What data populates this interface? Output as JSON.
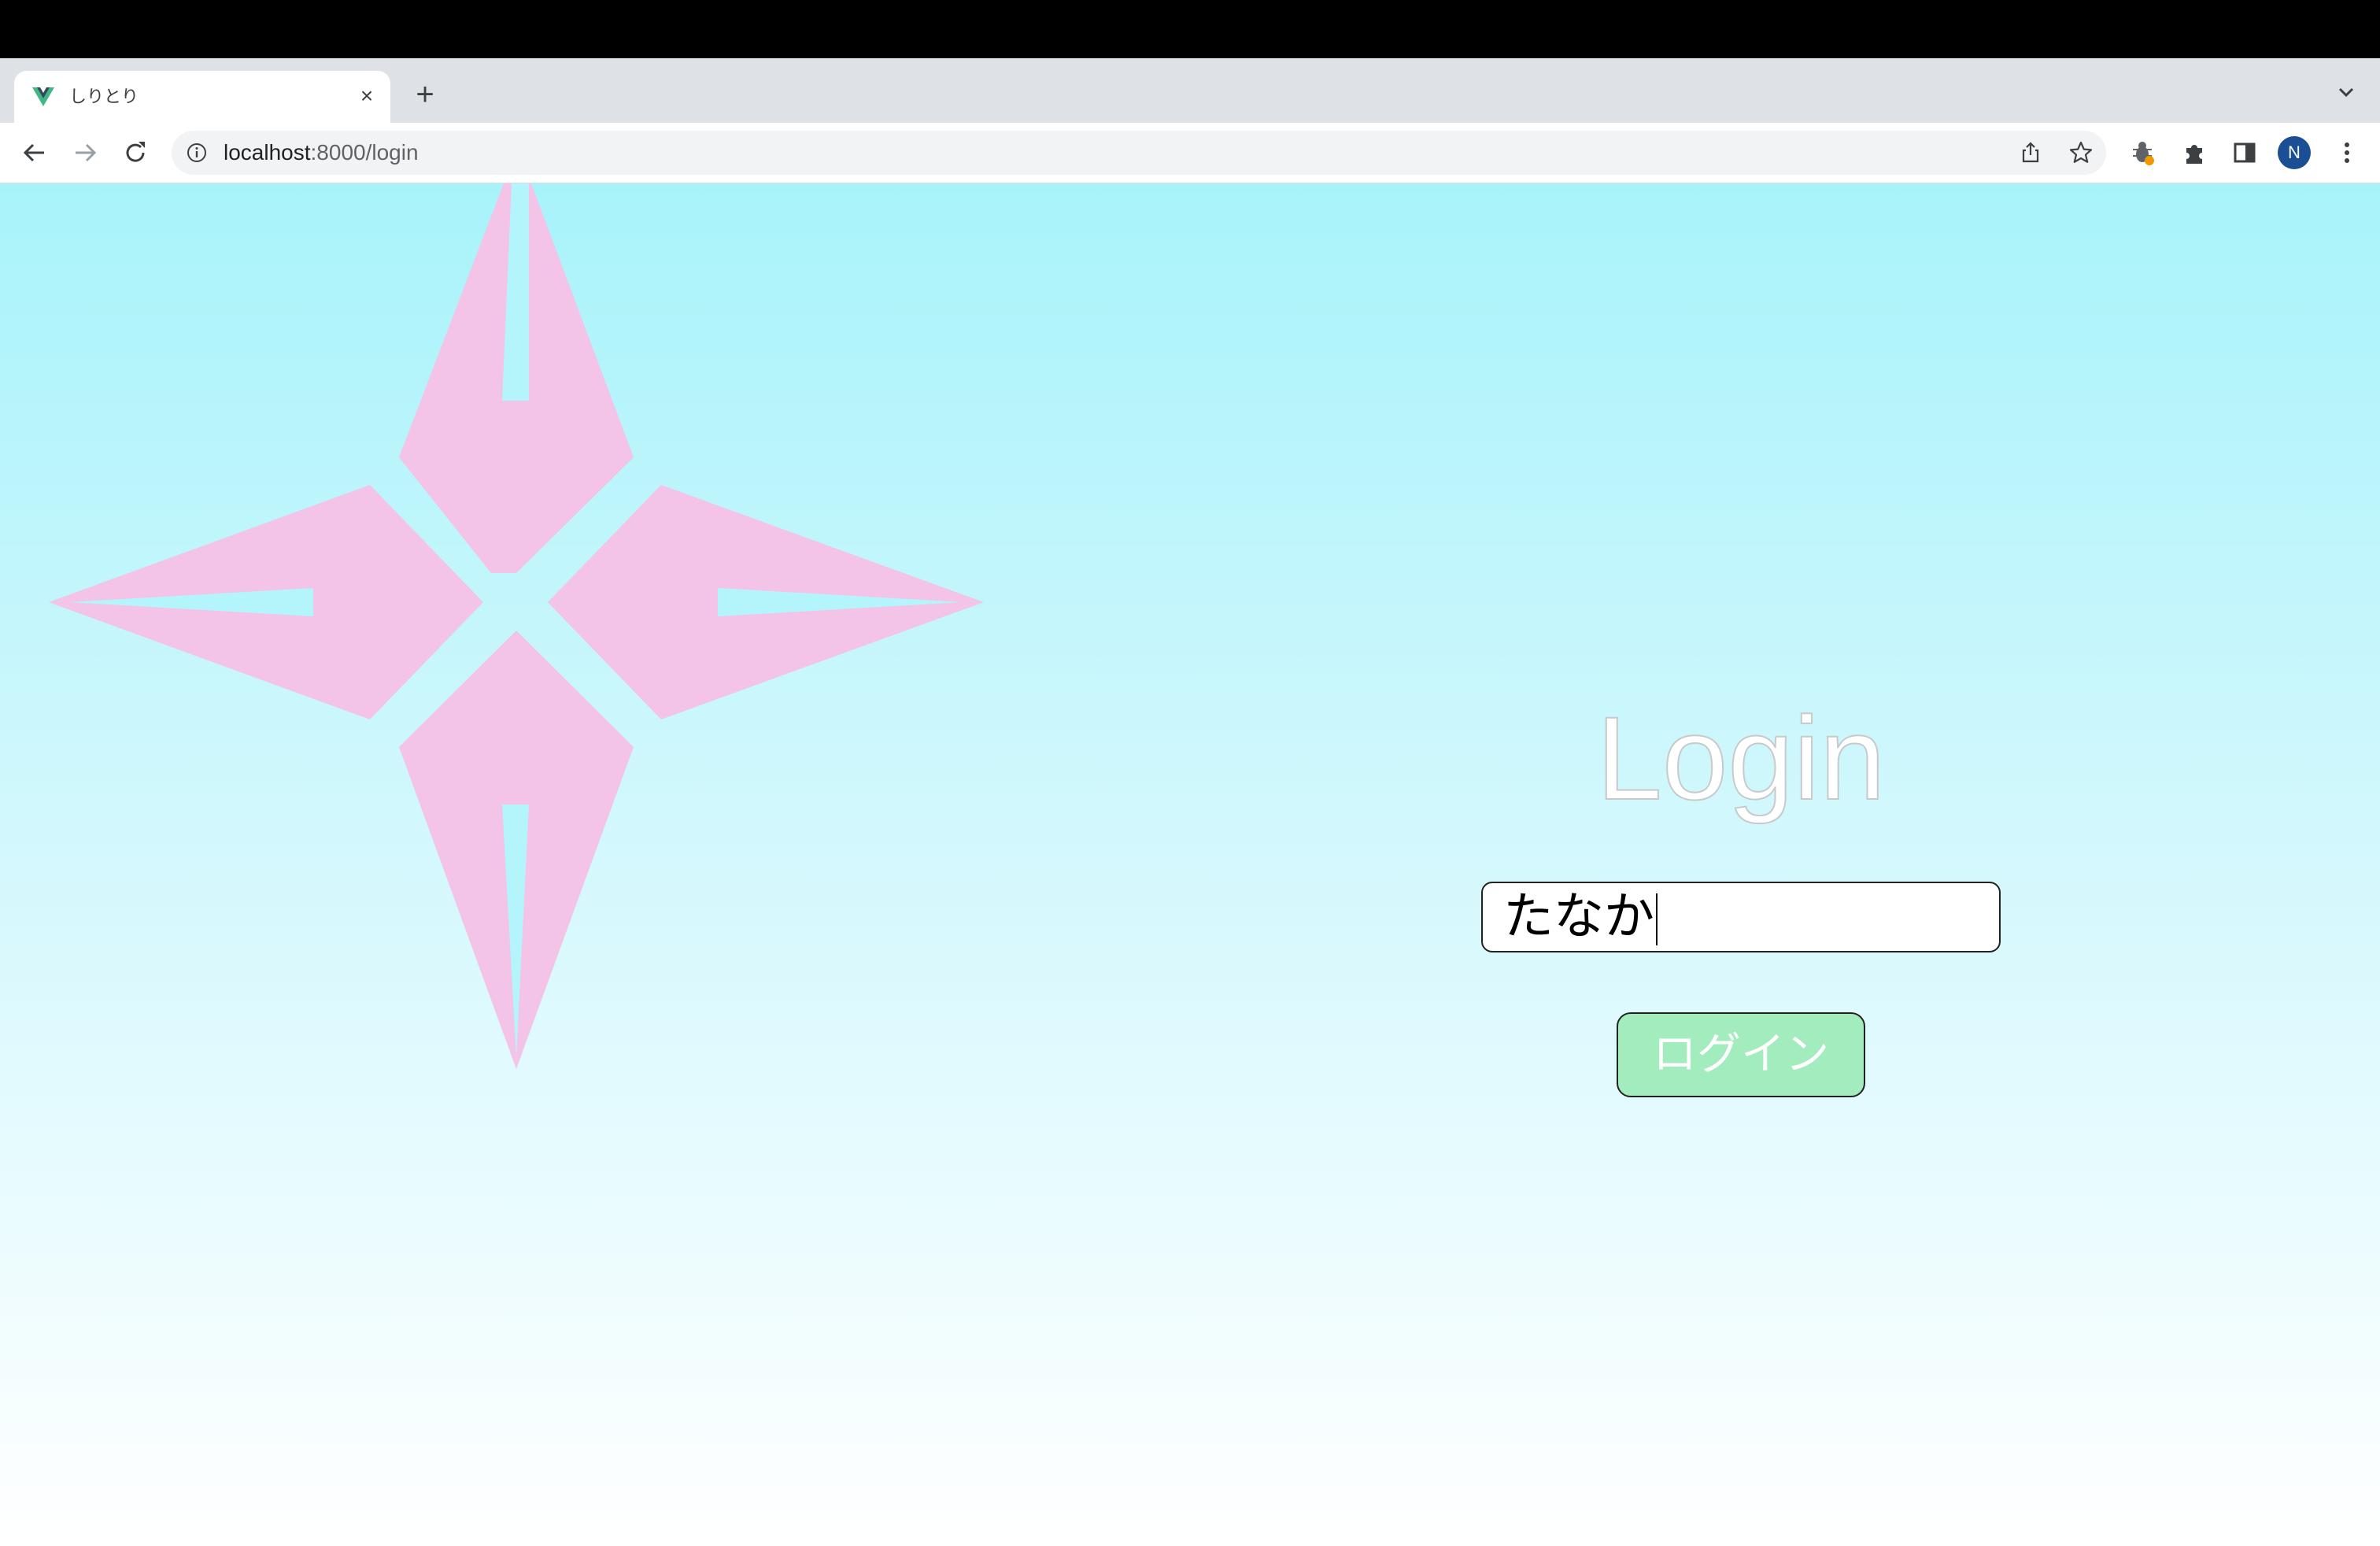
{
  "browser": {
    "tab": {
      "title": "しりとり",
      "favicon": "vue-logo-icon",
      "close_label": "×"
    },
    "new_tab_label": "+",
    "address_bar": {
      "host": "localhost",
      "path": ":8000/login"
    },
    "profile_initial": "N"
  },
  "page": {
    "title": "Login",
    "name_input": {
      "value": "たなか"
    },
    "login_button_label": "ログイン"
  },
  "colors": {
    "background_top": "#a8f3fa",
    "background_bottom": "#ffffff",
    "star": "#f4c3e8",
    "button": "#a3ecbd"
  }
}
